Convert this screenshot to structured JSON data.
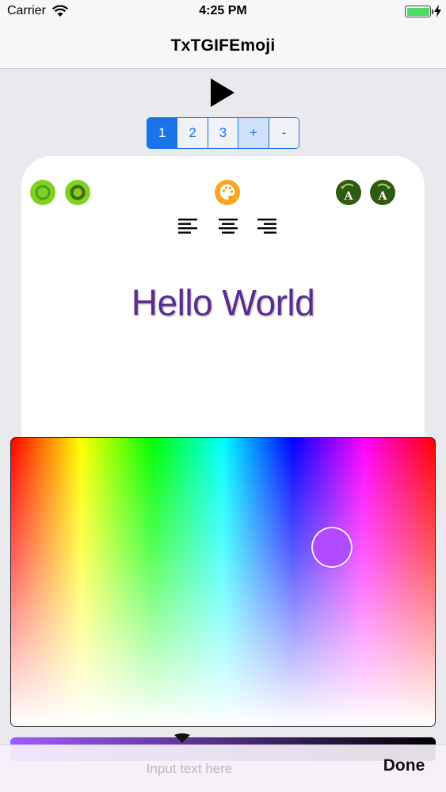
{
  "status_bar": {
    "carrier": "Carrier",
    "time": "4:25 PM",
    "battery_level": 1.0,
    "battery_color": "#4cd964"
  },
  "nav": {
    "title": "TxTGIFEmoji"
  },
  "player": {
    "play_icon": "play-icon"
  },
  "segments": {
    "items": [
      "1",
      "2",
      "3",
      "+",
      "-"
    ],
    "selected": "1",
    "accent": "#1a73e8"
  },
  "editor": {
    "left_tools": [
      "green-circle-icon",
      "green-ring-icon"
    ],
    "center_tool": "palette-icon",
    "right_tools": [
      "rotate-left-font-icon",
      "rotate-right-font-icon"
    ],
    "alignment_options": [
      "align-left-icon",
      "align-center-icon",
      "align-right-icon"
    ],
    "sample_text": "Hello World",
    "text_color": "#5b2d8e"
  },
  "color_picker": {
    "selected_color": "#b14bff"
  },
  "input_bar": {
    "placeholder": "Input text here",
    "value": "",
    "done_label": "Done"
  }
}
